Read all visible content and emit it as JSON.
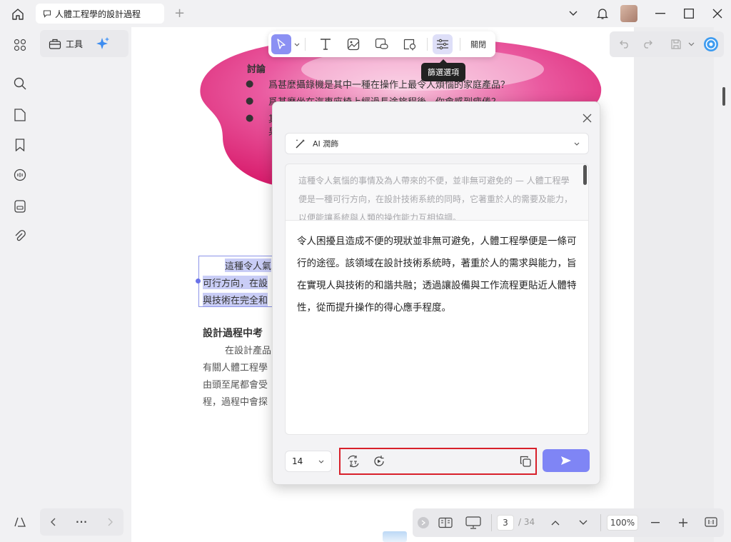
{
  "window": {
    "tab_title": "人體工程學的設計過程",
    "new_tab": "+"
  },
  "tools": {
    "label": "工具"
  },
  "toolbar": {
    "tooltip": "篩選選項",
    "close": "關閉"
  },
  "document": {
    "heading": "討論",
    "bullets": [
      "爲甚麼攝錄機是其中一種在操作上最令人煩惱的家庭產品？",
      "爲甚麼坐在汽車座椅上經過長途旅程後，你會感到疲倦？",
      "其"
    ],
    "bullet_extra": "果",
    "selected_lines": [
      "這種令人氣",
      "可行方向，在設",
      "與技術在完全和"
    ],
    "section_title": "設計過程中考",
    "para_lines": [
      "在設計產品",
      "有關人體工程學",
      "由頭至尾都會受",
      "程，過程中會探"
    ]
  },
  "dialog": {
    "dropdown_label": "AI 潤飾",
    "original_text": "這種令人氣惱的事情及為人帶來的不便，並非無可避免的 — 人體工程學便是一種可行方向，在設計技術系統的同時，它著重於人的需要及能力，以便能讓系統與人類的操作能力互相協調。",
    "result_text": "令人困擾且造成不便的現狀並非無可避免，人體工程學便是一條可行的途徑。該領域在設計技術系統時，著重於人的需求與能力，旨在實現人與技術的和諧共融；透過讓設備與工作流程更貼近人體特性，從而提升操作的得心應手程度。",
    "font_size": "14"
  },
  "navbar": {
    "more": "···"
  },
  "pagebar": {
    "current_page": "3",
    "total": "/ 34",
    "zoom": "100%"
  },
  "colors": {
    "accent": "#7f85f5",
    "highlight": "#c9cdf6",
    "red_box": "#d8202a",
    "bubble": "#e0307e"
  }
}
